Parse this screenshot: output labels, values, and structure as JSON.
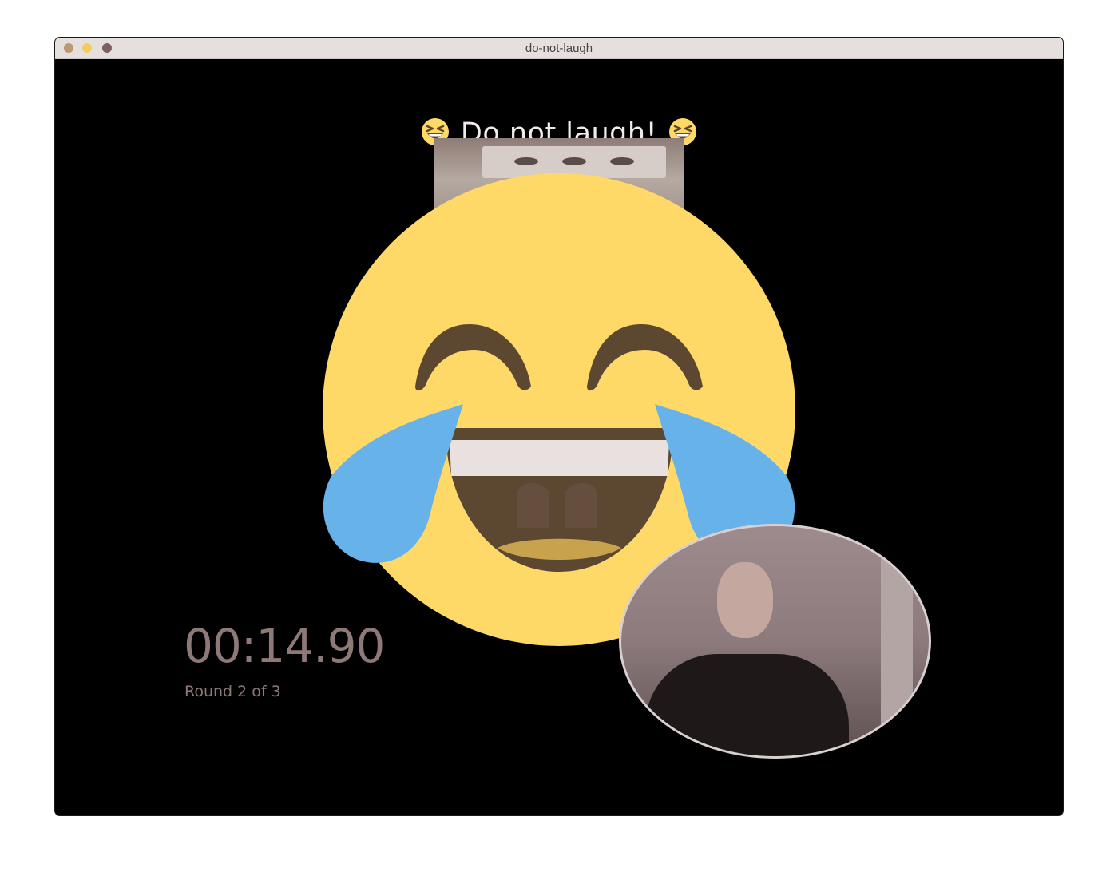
{
  "window": {
    "title": "do-not-laugh"
  },
  "header": {
    "title": "Do not laugh!",
    "left_icon": "grinning-squinting-face-icon",
    "right_icon": "grinning-squinting-face-icon"
  },
  "overlay": {
    "icon": "face-with-tears-of-joy-icon"
  },
  "status": {
    "timer": "00:14.90",
    "round": "Round 2 of 3"
  },
  "colors": {
    "background": "#000000",
    "titlebar": "#e5dfdd",
    "emoji_face": "#ffd968",
    "emoji_tears": "#66b2e9",
    "emoji_features": "#5c4731",
    "timer_text": "#8f7878",
    "heading_text": "#f1ebea"
  }
}
